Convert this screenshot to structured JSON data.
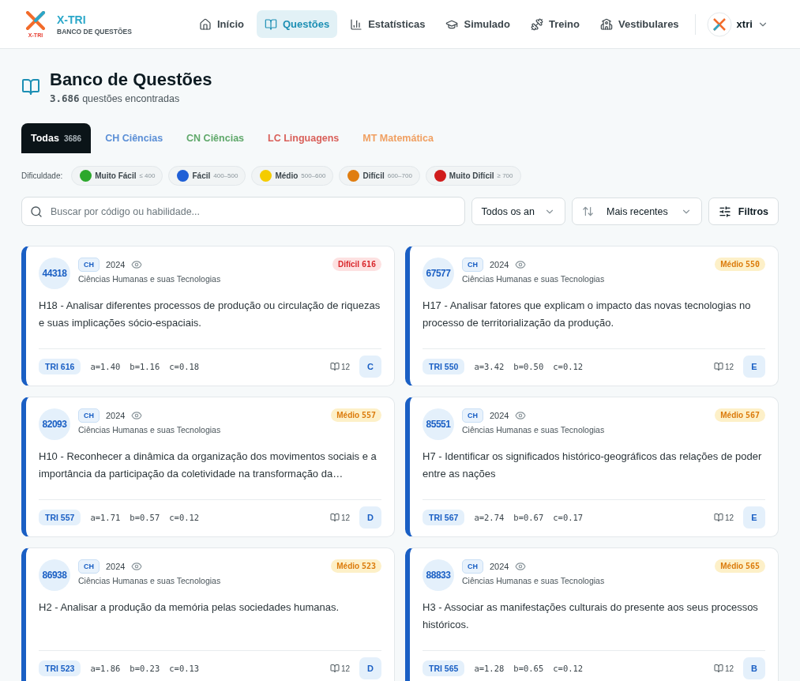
{
  "brand": {
    "name": "X-TRI",
    "logo_text": "X-TRI",
    "subtitle": "BANCO DE QUESTÕES"
  },
  "nav": [
    {
      "label": "Início",
      "kind": "home",
      "selected": false
    },
    {
      "label": "Questões",
      "kind": "book",
      "selected": true
    },
    {
      "label": "Estatísticas",
      "kind": "chart",
      "selected": false
    },
    {
      "label": "Simulado",
      "kind": "cap",
      "selected": false
    },
    {
      "label": "Treino",
      "kind": "dumbbell",
      "selected": false
    },
    {
      "label": "Vestibulares",
      "kind": "school",
      "selected": false
    }
  ],
  "user": {
    "name": "xtri"
  },
  "page": {
    "title": "Banco de Questões",
    "count": "3.686",
    "count_label": "questões encontradas"
  },
  "tabs": [
    {
      "label": "Todas",
      "count": "3686",
      "selected": true,
      "color": "#0b1418"
    },
    {
      "label": "CH Ciências",
      "selected": false,
      "color": "#5b8fd6"
    },
    {
      "label": "CN Ciências",
      "selected": false,
      "color": "#5fa86a"
    },
    {
      "label": "LC Linguagens",
      "selected": false,
      "color": "#d9605a"
    },
    {
      "label": "MT Matemática",
      "selected": false,
      "color": "#f0a062"
    }
  ],
  "difficulty": {
    "label": "Dificuldade:",
    "levels": [
      {
        "name": "Muito Fácil",
        "range": "≤ 400",
        "color": "#2ca82c"
      },
      {
        "name": "Fácil",
        "range": "400–500",
        "color": "#1f5fd6"
      },
      {
        "name": "Médio",
        "range": "500–600",
        "color": "#f5cc00"
      },
      {
        "name": "Difícil",
        "range": "600–700",
        "color": "#e07d10"
      },
      {
        "name": "Muito Difícil",
        "range": "≥ 700",
        "color": "#d01c1c"
      }
    ]
  },
  "search": {
    "placeholder": "Buscar por código ou habilidade..."
  },
  "year_filter": {
    "value": "Todos os an"
  },
  "sort": {
    "value": "Mais recentes"
  },
  "filters_button": {
    "label": "Filtros"
  },
  "questions": [
    {
      "code": "44318",
      "area": "CH",
      "year": "2024",
      "area_name": "Ciências Humanas e suas Tecnologias",
      "kind": "hard",
      "level_label": "Difícil",
      "level_score": "616",
      "tri_label": "TRI",
      "tri_score": "616",
      "skill": "H18 - Analisar diferentes processos de produção ou circulação de riquezas e suas implicações sócio-espaciais.",
      "a": "a=1.40",
      "b": "b=1.16",
      "c": "c=0.18",
      "pages": "12",
      "answer": "C"
    },
    {
      "code": "67577",
      "area": "CH",
      "year": "2024",
      "area_name": "Ciências Humanas e suas Tecnologias",
      "kind": "medium",
      "level_label": "Médio",
      "level_score": "550",
      "tri_label": "TRI",
      "tri_score": "550",
      "skill": "H17 - Analisar fatores que explicam o impacto das novas tecnologias no processo de territorialização da produção.",
      "a": "a=3.42",
      "b": "b=0.50",
      "c": "c=0.12",
      "pages": "12",
      "answer": "E"
    },
    {
      "code": "82093",
      "area": "CH",
      "year": "2024",
      "area_name": "Ciências Humanas e suas Tecnologias",
      "kind": "medium",
      "level_label": "Médio",
      "level_score": "557",
      "tri_label": "TRI",
      "tri_score": "557",
      "skill": "H10 - Reconhecer a dinâmica da organização dos movimentos sociais e a importância da participação da coletividade na transformação da…",
      "a": "a=1.71",
      "b": "b=0.57",
      "c": "c=0.12",
      "pages": "12",
      "answer": "D"
    },
    {
      "code": "85551",
      "area": "CH",
      "year": "2024",
      "area_name": "Ciências Humanas e suas Tecnologias",
      "kind": "medium",
      "level_label": "Médio",
      "level_score": "567",
      "tri_label": "TRI",
      "tri_score": "567",
      "skill": "H7 - Identificar os significados histórico-geográficos das relações de poder entre as nações",
      "a": "a=2.74",
      "b": "b=0.67",
      "c": "c=0.17",
      "pages": "12",
      "answer": "E"
    },
    {
      "code": "86938",
      "area": "CH",
      "year": "2024",
      "area_name": "Ciências Humanas e suas Tecnologias",
      "kind": "medium",
      "level_label": "Médio",
      "level_score": "523",
      "tri_label": "TRI",
      "tri_score": "523",
      "skill": "H2 - Analisar a produção da memória pelas sociedades humanas.",
      "a": "a=1.86",
      "b": "b=0.23",
      "c": "c=0.13",
      "pages": "12",
      "answer": "D"
    },
    {
      "code": "88833",
      "area": "CH",
      "year": "2024",
      "area_name": "Ciências Humanas e suas Tecnologias",
      "kind": "medium",
      "level_label": "Médio",
      "level_score": "565",
      "tri_label": "TRI",
      "tri_score": "565",
      "skill": "H3 - Associar as manifestações culturais do presente aos seus processos históricos.",
      "a": "a=1.28",
      "b": "b=0.65",
      "c": "c=0.12",
      "pages": "12",
      "answer": "B"
    }
  ]
}
